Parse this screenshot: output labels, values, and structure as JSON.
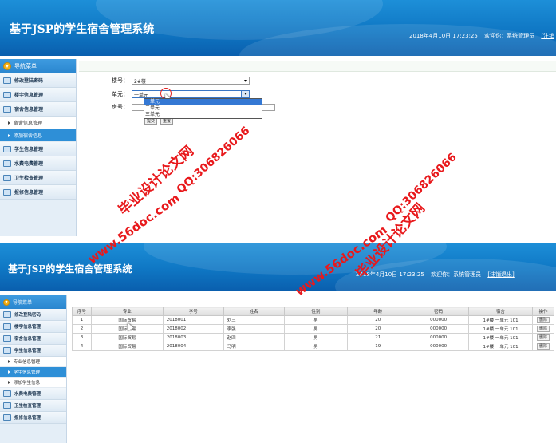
{
  "app": {
    "title": "基于JSP的学生宿舍管理系统",
    "datetime": "2018年4月10日  17:23:25",
    "welcome": "欢迎你：系统管理员",
    "logout": "[注销退出]",
    "logout_cut": "[注销"
  },
  "sidebar": {
    "header": "导航菜单",
    "top_items": [
      {
        "label": "修改登陆密码"
      },
      {
        "label": "楼宇信息管理"
      },
      {
        "label": "宿舍信息管理"
      }
    ],
    "top_sub": [
      {
        "label": "宿舍信息管理"
      },
      {
        "label": "添加宿舍信息"
      }
    ],
    "top_bottom_items": [
      {
        "label": "学生信息管理"
      },
      {
        "label": "水费电费管理"
      },
      {
        "label": "卫生检查管理"
      },
      {
        "label": "报修信息管理"
      }
    ],
    "bottom_items": [
      {
        "label": "修改登陆密码"
      },
      {
        "label": "楼宇信息管理"
      },
      {
        "label": "宿舍信息管理"
      },
      {
        "label": "学生信息管理"
      }
    ],
    "bottom_sub": [
      {
        "label": "专业信息管理"
      },
      {
        "label": "学生信息管理"
      },
      {
        "label": "添加学生信息"
      }
    ],
    "bottom_bottom_items": [
      {
        "label": "水费电费管理"
      },
      {
        "label": "卫生检查管理"
      },
      {
        "label": "报修信息管理"
      }
    ]
  },
  "form": {
    "building_label": "楼号：",
    "building_value": "2#楼",
    "unit_label": "单元：",
    "unit_value": "一单元",
    "room_label": "房号：",
    "unit_options": [
      "一单元",
      "二单元",
      "三单元"
    ],
    "submit_label": "提交",
    "reset_label": "重置"
  },
  "table": {
    "headers": [
      "序号",
      "专业",
      "学号",
      "姓名",
      "性别",
      "年龄",
      "密码",
      "宿舍",
      "操作"
    ],
    "rows": [
      [
        "1",
        "国际贸易",
        "2018001",
        "刘三",
        "男",
        "20",
        "000000",
        "1#楼  一单元  101",
        "删除"
      ],
      [
        "2",
        "国际贸易",
        "2018002",
        "李强",
        "男",
        "20",
        "000000",
        "1#楼  一单元  101",
        "删除"
      ],
      [
        "3",
        "国际贸易",
        "2018003",
        "赵四",
        "男",
        "21",
        "000000",
        "1#楼  一单元  101",
        "删除"
      ],
      [
        "4",
        "国际贸易",
        "2018004",
        "马明",
        "男",
        "19",
        "000000",
        "1#楼  一单元  101",
        "删除"
      ]
    ]
  },
  "watermarks": {
    "site": "www.56doc.com",
    "brand": "毕业设计论文网",
    "qq": "QQ:306826066"
  },
  "colors": {
    "header_blue": "#0f77c4",
    "active_blue": "#2e8fd7",
    "watermark_red": "#e8191c"
  }
}
